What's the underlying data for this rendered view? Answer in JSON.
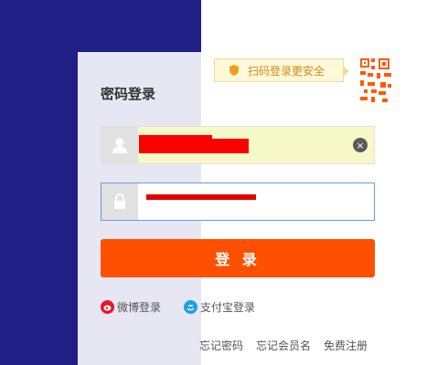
{
  "login": {
    "title": "密码登录",
    "qr_tip": "扫码登录更安全",
    "submit_label": "登 录",
    "clear_symbol": "×"
  },
  "social": {
    "weibo_label": "微博登录",
    "alipay_label": "支付宝登录"
  },
  "links": {
    "forgot_password": "忘记密码",
    "forgot_username": "忘记会员名",
    "register": "免费注册"
  },
  "colors": {
    "left_background": "#1f1f86",
    "accent": "#ff4f00",
    "tip_text": "#d68a1a",
    "redaction": "#ff0000"
  }
}
